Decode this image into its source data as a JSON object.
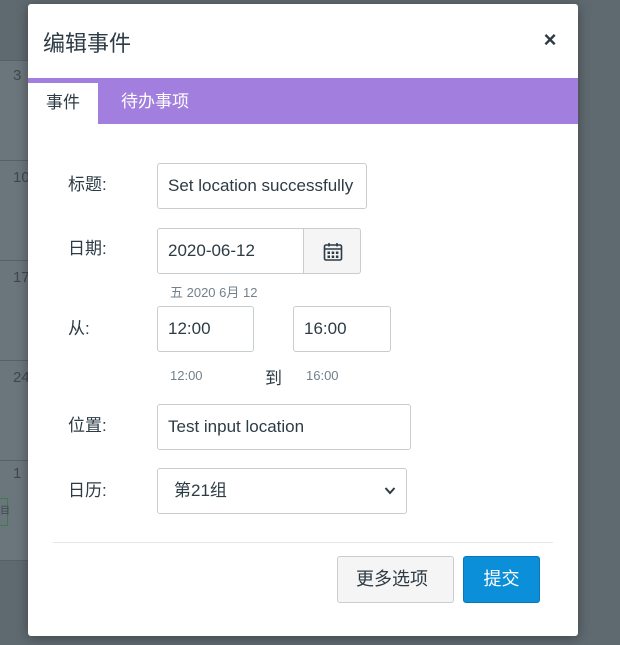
{
  "background": {
    "day_numbers": [
      "3",
      "10",
      "17",
      "24",
      "1"
    ],
    "mini_event": "目"
  },
  "dialog": {
    "title": "编辑事件",
    "close_glyph": "×",
    "tabs": [
      {
        "label": "事件",
        "active": true
      },
      {
        "label": "待办事项",
        "active": false
      }
    ],
    "fields": {
      "title": {
        "label": "标题:",
        "value": "Set location successfully"
      },
      "date": {
        "label": "日期:",
        "value": "2020-06-12",
        "hint": "五 2020 6月 12"
      },
      "from": {
        "label": "从:",
        "start": "12:00",
        "start_hint": "12:00",
        "to_label": "到",
        "end": "16:00",
        "end_hint": "16:00"
      },
      "location": {
        "label": "位置:",
        "value": "Test input location"
      },
      "calendar": {
        "label": "日历:",
        "value": "第21组"
      }
    },
    "buttons": {
      "more_options": "更多选项",
      "submit": "提交"
    }
  },
  "colors": {
    "tab_bar": "#a27fde",
    "primary_button": "#0b8fd8",
    "backdrop": "#5f6a70"
  },
  "icons": {
    "calendar_button": "calendar-icon",
    "select_arrow": "chevron-down-icon",
    "close": "close-icon"
  }
}
